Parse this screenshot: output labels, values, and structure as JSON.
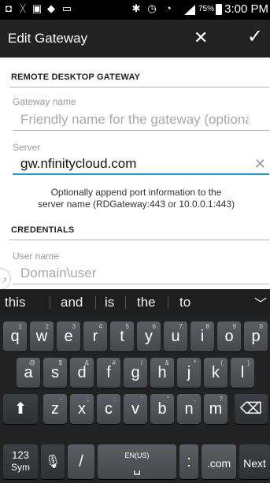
{
  "status_bar": {
    "time": "3:00 PM",
    "battery": "75%",
    "icons": [
      "notification-icon",
      "missed-call-icon",
      "gallery-icon",
      "app-icon",
      "voicemail-icon",
      "bluetooth-icon",
      "alarm-icon",
      "wifi-icon",
      "signal-icon",
      "battery-icon"
    ]
  },
  "action_bar": {
    "title": "Edit Gateway",
    "close_icon": "close-icon",
    "done_icon": "check-icon"
  },
  "form": {
    "remote_desktop_gateway": {
      "section_title": "REMOTE DESKTOP GATEWAY",
      "gateway_name": {
        "label": "Gateway name",
        "placeholder": "Friendly name for the gateway (optional)",
        "value": ""
      },
      "server": {
        "label": "Server",
        "value": "gw.nfinitycloud.com"
      },
      "hint_line1": "Optionally append port information to the",
      "hint_line2": "server name (RDGateway:443 or 10.0.0.1:443)"
    },
    "credentials": {
      "section_title": "CREDENTIALS",
      "user_name": {
        "label": "User name",
        "placeholder": "Domain\\user",
        "value": ""
      }
    }
  },
  "suggestions": [
    "this",
    "and",
    "is",
    "the",
    "to"
  ],
  "keyboard": {
    "row1": [
      {
        "key": "q",
        "sub": "1"
      },
      {
        "key": "w",
        "sub": "2"
      },
      {
        "key": "e",
        "sub": "3"
      },
      {
        "key": "r",
        "sub": "4"
      },
      {
        "key": "t",
        "sub": "5"
      },
      {
        "key": "y",
        "sub": "6"
      },
      {
        "key": "u",
        "sub": "7"
      },
      {
        "key": "i",
        "sub": "8"
      },
      {
        "key": "o",
        "sub": "9"
      },
      {
        "key": "p",
        "sub": "0"
      }
    ],
    "row2": [
      {
        "key": "a",
        "sub": "@"
      },
      {
        "key": "s",
        "sub": "$"
      },
      {
        "key": "d",
        "sub": "&"
      },
      {
        "key": "f",
        "sub": "#"
      },
      {
        "key": "g",
        "sub": "/"
      },
      {
        "key": "h",
        "sub": "&"
      },
      {
        "key": "j",
        "sub": "*"
      },
      {
        "key": "k",
        "sub": "("
      },
      {
        "key": "l",
        "sub": ")"
      }
    ],
    "row3": [
      {
        "key": "z",
        "sub": "-"
      },
      {
        "key": "x",
        "sub": ";"
      },
      {
        "key": "c",
        "sub": ":"
      },
      {
        "key": "v",
        "sub": "'"
      },
      {
        "key": "b",
        "sub": "\""
      },
      {
        "key": "n",
        "sub": ","
      },
      {
        "key": "m",
        "sub": "?"
      }
    ],
    "shift_glyph": "⬆",
    "backspace_glyph": "⌫",
    "sym_label_top": "123",
    "sym_label_bottom": "Sym",
    "mic_glyph": "🎙",
    "slash_key": "/",
    "space_label": "EN(US)",
    "space_glyph": "␣",
    "colon_key": ":",
    "dotcom_key": ".com",
    "next_key": "Next"
  }
}
